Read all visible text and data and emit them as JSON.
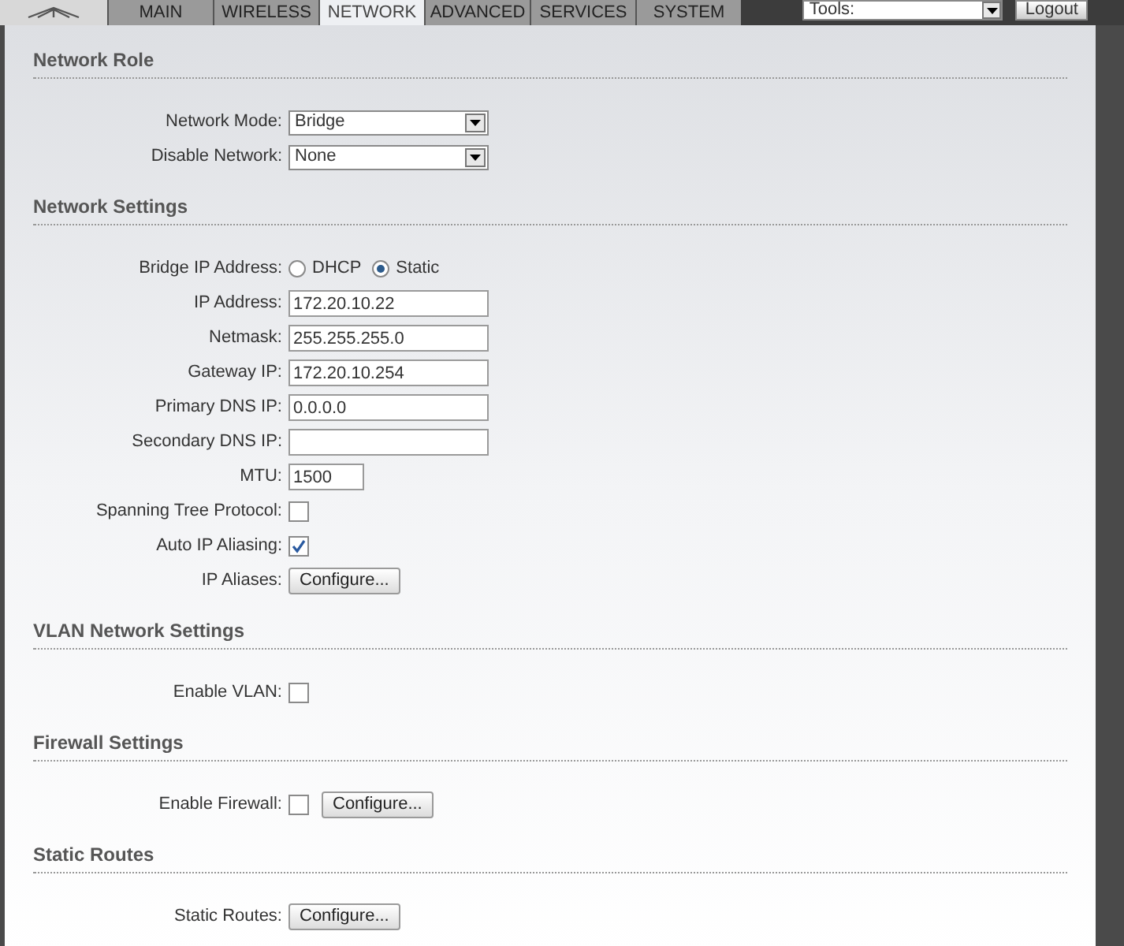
{
  "tabs": [
    {
      "label": "MAIN",
      "selected": false
    },
    {
      "label": "WIRELESS",
      "selected": false
    },
    {
      "label": "NETWORK",
      "selected": true
    },
    {
      "label": "ADVANCED",
      "selected": false
    },
    {
      "label": "SERVICES",
      "selected": false
    },
    {
      "label": "SYSTEM",
      "selected": false
    }
  ],
  "tools": {
    "value": "Tools:"
  },
  "logout": "Logout",
  "sections": [
    {
      "title": "Network Role",
      "rows": [
        {
          "kind": "select",
          "label": "Network Mode:",
          "value": "Bridge"
        },
        {
          "kind": "select",
          "label": "Disable Network:",
          "value": "None"
        }
      ]
    },
    {
      "title": "Network Settings",
      "rows": [
        {
          "kind": "radio",
          "label": "Bridge IP Address:",
          "options": [
            {
              "label": "DHCP",
              "selected": false
            },
            {
              "label": "Static",
              "selected": true
            }
          ]
        },
        {
          "kind": "text",
          "label": "IP Address:",
          "value": "172.20.10.22"
        },
        {
          "kind": "text",
          "label": "Netmask:",
          "value": "255.255.255.0"
        },
        {
          "kind": "text",
          "label": "Gateway IP:",
          "value": "172.20.10.254"
        },
        {
          "kind": "text",
          "label": "Primary DNS IP:",
          "value": "0.0.0.0"
        },
        {
          "kind": "text",
          "label": "Secondary DNS IP:"
        },
        {
          "kind": "short_text",
          "label": "MTU:",
          "value": "1500"
        },
        {
          "kind": "checkbox",
          "label": "Spanning Tree Protocol:",
          "checked": false
        },
        {
          "kind": "checkbox",
          "label": "Auto IP Aliasing:",
          "checked": true
        },
        {
          "kind": "button",
          "label": "IP Aliases:",
          "button": "Configure..."
        }
      ]
    },
    {
      "title": "VLAN Network Settings",
      "rows": [
        {
          "kind": "checkbox",
          "label": "Enable VLAN:",
          "checked": false
        }
      ]
    },
    {
      "title": "Firewall Settings",
      "rows": [
        {
          "kind": "checkbox",
          "label": "Enable Firewall:",
          "checked": false,
          "button": "Configure..."
        }
      ]
    },
    {
      "title": "Static Routes",
      "rows": [
        {
          "kind": "button",
          "label": "Static Routes:",
          "button": "Configure..."
        }
      ]
    }
  ]
}
